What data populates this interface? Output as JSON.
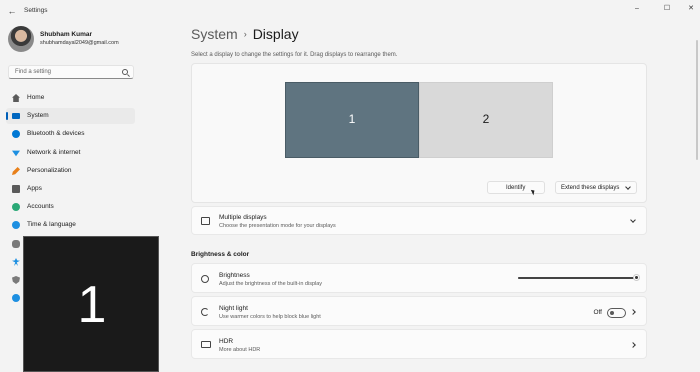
{
  "window": {
    "title": "Settings",
    "back_glyph": "←",
    "min_glyph": "–",
    "max_glyph": "☐",
    "close_glyph": "✕"
  },
  "profile": {
    "name": "Shubham Kumar",
    "email": "shubhamdayal2049@gmail.com"
  },
  "search": {
    "placeholder": "Find a setting"
  },
  "sidebar": {
    "items": [
      {
        "label": "Home",
        "icon": "home-icon",
        "color": "#5a5a5a"
      },
      {
        "label": "System",
        "icon": "system-icon",
        "color": "#0067c0"
      },
      {
        "label": "Bluetooth & devices",
        "icon": "bluetooth-icon",
        "color": "#0078d4"
      },
      {
        "label": "Network & internet",
        "icon": "wifi-icon",
        "color": "#1d8fe1"
      },
      {
        "label": "Personalization",
        "icon": "brush-icon",
        "color": "#e8801a"
      },
      {
        "label": "Apps",
        "icon": "apps-icon",
        "color": "#5a5a5a"
      },
      {
        "label": "Accounts",
        "icon": "account-icon",
        "color": "#2aa876"
      },
      {
        "label": "Time & language",
        "icon": "globe-clock-icon",
        "color": "#1d8fe1"
      }
    ],
    "partial_icons": [
      {
        "icon": "gaming-icon",
        "color": "#7a7a7a"
      },
      {
        "icon": "accessibility-icon",
        "color": "#1d8fe1"
      },
      {
        "icon": "privacy-shield-icon",
        "color": "#7a7a7a"
      },
      {
        "icon": "windows-update-icon",
        "color": "#1d8fe1"
      }
    ]
  },
  "identify_overlay": {
    "number": "1"
  },
  "breadcrumb": {
    "parent": "System",
    "separator": "›",
    "current": "Display"
  },
  "hint": "Select a display to change the settings for it. Drag displays to rearrange them.",
  "arrangement": {
    "monitors": [
      {
        "number": "1",
        "selected": true
      },
      {
        "number": "2",
        "selected": false
      }
    ],
    "identify_label": "Identify",
    "mode_label": "Extend these displays"
  },
  "multiple_displays": {
    "title": "Multiple displays",
    "subtitle": "Choose the presentation mode for your displays"
  },
  "brightness_section": {
    "title": "Brightness & color"
  },
  "brightness": {
    "title": "Brightness",
    "subtitle": "Adjust the brightness of the built-in display",
    "level_percent": 100
  },
  "night_light": {
    "title": "Night light",
    "subtitle": "Use warmer colors to help block blue light",
    "state_label": "Off"
  },
  "hdr": {
    "title": "HDR",
    "subtitle": "More about HDR"
  },
  "colors": {
    "accent": "#005fb8",
    "monitor_selected": "#5f7480",
    "monitor_unselected": "#d9d9d9"
  }
}
